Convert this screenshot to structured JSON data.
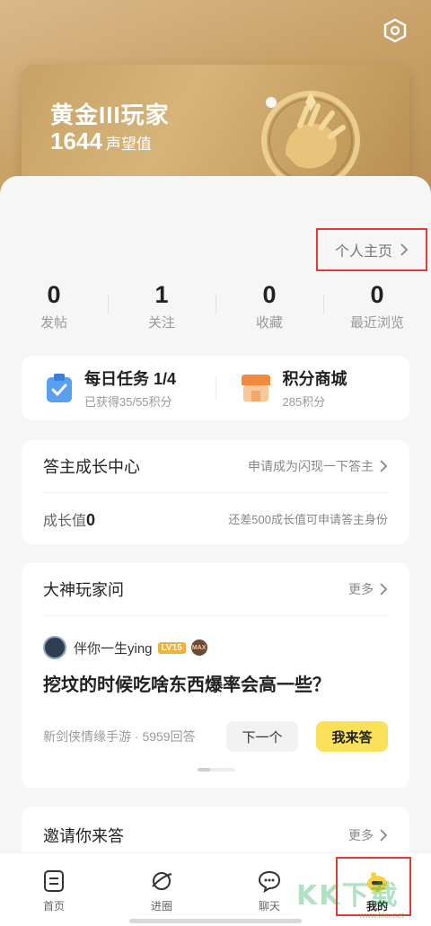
{
  "hero": {
    "level_title": "黄金III玩家",
    "score": "1644",
    "score_label": "声望值"
  },
  "profile_link": "个人主页",
  "stats": [
    {
      "num": "0",
      "label": "发帖"
    },
    {
      "num": "1",
      "label": "关注"
    },
    {
      "num": "0",
      "label": "收藏"
    },
    {
      "num": "0",
      "label": "最近浏览"
    }
  ],
  "tasks": {
    "daily": {
      "title": "每日任务 1/4",
      "sub": "已获得35/55积分"
    },
    "shop": {
      "title": "积分商城",
      "sub": "285积分"
    }
  },
  "growth": {
    "title": "答主成长中心",
    "link": "申请成为闪现一下答主",
    "value_label": "成长值",
    "value": "0",
    "note": "还差500成长值可申请答主身份"
  },
  "ask": {
    "title": "大神玩家问",
    "more": "更多",
    "user": "伴你一生ying",
    "level_badge": "LV15",
    "max_badge": "MAX",
    "question": "挖坟的时候吃啥东西爆率会高一些？",
    "meta": "新剑侠情缘手游 · 5959回答",
    "next_btn": "下一个",
    "answer_btn": "我来答"
  },
  "invite": {
    "title": "邀请你来答",
    "more": "更多"
  },
  "tabbar": [
    {
      "label": "首页",
      "icon": "home-icon"
    },
    {
      "label": "进圈",
      "icon": "planet-icon"
    },
    {
      "label": "聊天",
      "icon": "chat-icon"
    },
    {
      "label": "我的",
      "icon": "profile-mascot-icon"
    }
  ],
  "watermark": {
    "text": "KK下载",
    "url": "www.kkx.net"
  }
}
